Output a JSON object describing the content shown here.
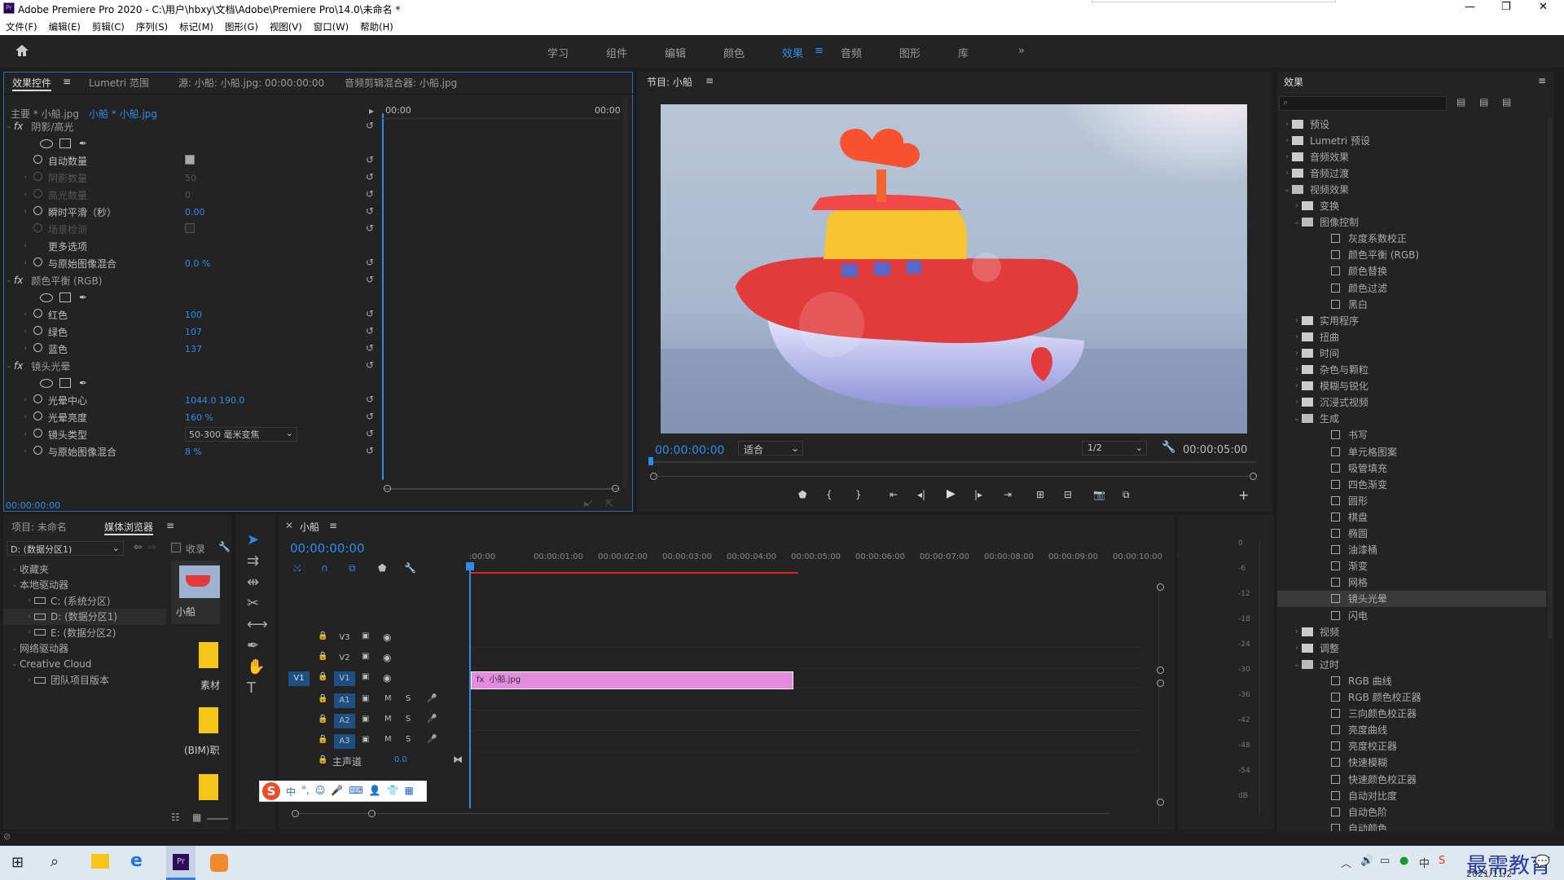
{
  "window": {
    "title": "Adobe Premiere Pro 2020 - C:\\用户\\hbxy\\文档\\Adobe\\Premiere Pro\\14.0\\未命名 *",
    "controls": [
      "—",
      "❐",
      "✕"
    ]
  },
  "menu": [
    "文件(F)",
    "编辑(E)",
    "剪辑(C)",
    "序列(S)",
    "标记(M)",
    "图形(G)",
    "视图(V)",
    "窗口(W)",
    "帮助(H)"
  ],
  "workspaces": [
    "学习",
    "组件",
    "编辑",
    "颜色",
    "效果",
    "音频",
    "图形",
    "库"
  ],
  "workspaces_active": "效果",
  "effect_controls": {
    "tabs": [
      "效果控件",
      "Lumetri 范围",
      "源: 小船: 小船.jpg: 00:00:00:00",
      "音频剪辑混合器: 小船.jpg"
    ],
    "master": "主要 * 小船.jpg",
    "clip": "小船 * 小船.jpg",
    "time_start": "00:00",
    "time_end": "00:00",
    "sections": [
      {
        "title": "阴影/高光",
        "rows": [
          {
            "label": "自动数量",
            "value": "",
            "type": "check-on"
          },
          {
            "label": "阴影数量",
            "value": "50",
            "type": "dim"
          },
          {
            "label": "高光数量",
            "value": "0",
            "type": "dim"
          },
          {
            "label": "瞬时平滑（秒）",
            "value": "0.00",
            "type": "val"
          },
          {
            "label": "场景检测",
            "value": "",
            "type": "check-dim"
          },
          {
            "label": "更多选项",
            "value": "",
            "type": "plain"
          },
          {
            "label": "与原始图像混合",
            "value": "0.0 %",
            "type": "val"
          }
        ]
      },
      {
        "title": "颜色平衡 (RGB)",
        "rows": [
          {
            "label": "红色",
            "value": "100",
            "type": "val"
          },
          {
            "label": "绿色",
            "value": "107",
            "type": "val"
          },
          {
            "label": "蓝色",
            "value": "137",
            "type": "val"
          }
        ]
      },
      {
        "title": "镜头光晕",
        "rows": [
          {
            "label": "光晕中心",
            "value": "1044.0     190.0",
            "type": "val"
          },
          {
            "label": "光晕亮度",
            "value": "160 %",
            "type": "val"
          },
          {
            "label": "镜头类型",
            "value": "50-300 毫米变焦",
            "type": "select"
          },
          {
            "label": "与原始图像混合",
            "value": "8 %",
            "type": "val"
          }
        ]
      }
    ],
    "timecode": "00:00:00:00"
  },
  "program": {
    "title": "节目: 小船",
    "timecode": "00:00:00:00",
    "fit": "适合",
    "quality": "1/2",
    "duration": "00:00:05:00"
  },
  "effects_panel": {
    "title": "效果",
    "search_placeholder": "",
    "tree": [
      {
        "d": 0,
        "t": "预设",
        "o": false
      },
      {
        "d": 0,
        "t": "Lumetri 预设",
        "o": false
      },
      {
        "d": 0,
        "t": "音频效果",
        "o": false
      },
      {
        "d": 0,
        "t": "音频过渡",
        "o": false
      },
      {
        "d": 0,
        "t": "视频效果",
        "o": true
      },
      {
        "d": 1,
        "t": "变换",
        "o": false
      },
      {
        "d": 1,
        "t": "图像控制",
        "o": true
      },
      {
        "d": 2,
        "t": "灰度系数校正"
      },
      {
        "d": 2,
        "t": "颜色平衡 (RGB)"
      },
      {
        "d": 2,
        "t": "颜色替换"
      },
      {
        "d": 2,
        "t": "颜色过滤"
      },
      {
        "d": 2,
        "t": "黑白"
      },
      {
        "d": 1,
        "t": "实用程序",
        "o": false
      },
      {
        "d": 1,
        "t": "扭曲",
        "o": false
      },
      {
        "d": 1,
        "t": "时间",
        "o": false
      },
      {
        "d": 1,
        "t": "杂色与颗粒",
        "o": false
      },
      {
        "d": 1,
        "t": "模糊与锐化",
        "o": false
      },
      {
        "d": 1,
        "t": "沉浸式视频",
        "o": false
      },
      {
        "d": 1,
        "t": "生成",
        "o": true
      },
      {
        "d": 2,
        "t": "书写"
      },
      {
        "d": 2,
        "t": "单元格图案"
      },
      {
        "d": 2,
        "t": "吸管填充"
      },
      {
        "d": 2,
        "t": "四色渐变"
      },
      {
        "d": 2,
        "t": "圆形"
      },
      {
        "d": 2,
        "t": "棋盘"
      },
      {
        "d": 2,
        "t": "椭圆"
      },
      {
        "d": 2,
        "t": "油漆桶"
      },
      {
        "d": 2,
        "t": "渐变"
      },
      {
        "d": 2,
        "t": "网格"
      },
      {
        "d": 2,
        "t": "镜头光晕",
        "sel": true
      },
      {
        "d": 2,
        "t": "闪电"
      },
      {
        "d": 1,
        "t": "视频",
        "o": false
      },
      {
        "d": 1,
        "t": "调整",
        "o": false
      },
      {
        "d": 1,
        "t": "过时",
        "o": true
      },
      {
        "d": 2,
        "t": "RGB 曲线"
      },
      {
        "d": 2,
        "t": "RGB 颜色校正器"
      },
      {
        "d": 2,
        "t": "三向颜色校正器"
      },
      {
        "d": 2,
        "t": "亮度曲线"
      },
      {
        "d": 2,
        "t": "亮度校正器"
      },
      {
        "d": 2,
        "t": "快速模糊"
      },
      {
        "d": 2,
        "t": "快速颜色校正器"
      },
      {
        "d": 2,
        "t": "自动对比度"
      },
      {
        "d": 2,
        "t": "自动色阶"
      },
      {
        "d": 2,
        "t": "自动颜色"
      }
    ]
  },
  "project": {
    "tabs": [
      "项目: 未命名",
      "媒体浏览器"
    ],
    "drive": "D: (数据分区1)",
    "ingest": "收录",
    "tree": [
      {
        "d": 0,
        "t": "收藏夹"
      },
      {
        "d": 0,
        "t": "本地驱动器"
      },
      {
        "d": 1,
        "t": "C: (系统分区)"
      },
      {
        "d": 1,
        "t": "D: (数据分区1)"
      },
      {
        "d": 1,
        "t": "E: (数据分区2)"
      },
      {
        "d": 0,
        "t": "网络驱动器"
      },
      {
        "d": 0,
        "t": "Creative Cloud"
      },
      {
        "d": 1,
        "t": "团队项目版本"
      }
    ],
    "thumbs": [
      "小船",
      "素材",
      "(BIM)职",
      ""
    ]
  },
  "timeline": {
    "title": "小船",
    "timecode": "00:00:00:00",
    "ruler": [
      ":00:00",
      "00:00:01:00",
      "00:00:02:00",
      "00:00:03:00",
      "00:00:04:00",
      "00:00:05:00",
      "00:00:06:00",
      "00:00:07:00",
      "00:00:08:00",
      "00:00:09:00",
      "00:00:10:00",
      "0"
    ],
    "tracks_video": [
      "V3",
      "V2",
      "V1"
    ],
    "tracks_audio": [
      "A1",
      "A2",
      "A3"
    ],
    "source_v": "V1",
    "master": "主声道",
    "master_val": "0.0",
    "clip": "小船.jpg",
    "meter": [
      "0",
      "-6",
      "-12",
      "-18",
      "-24",
      "-30",
      "-36",
      "-42",
      "-48",
      "-54",
      "dB"
    ]
  },
  "ime": {
    "label": "S",
    "items": [
      "中",
      "°,",
      "☺",
      "🎤",
      "⌨",
      "👤",
      "👕",
      "▦"
    ]
  },
  "taskbar": {
    "time": "",
    "date": "2021/11/2",
    "watermark": "最需教育"
  },
  "colors": {
    "accent": "#2d8ceb",
    "clip": "#e58be0",
    "playhead": "#2d8ceb"
  }
}
